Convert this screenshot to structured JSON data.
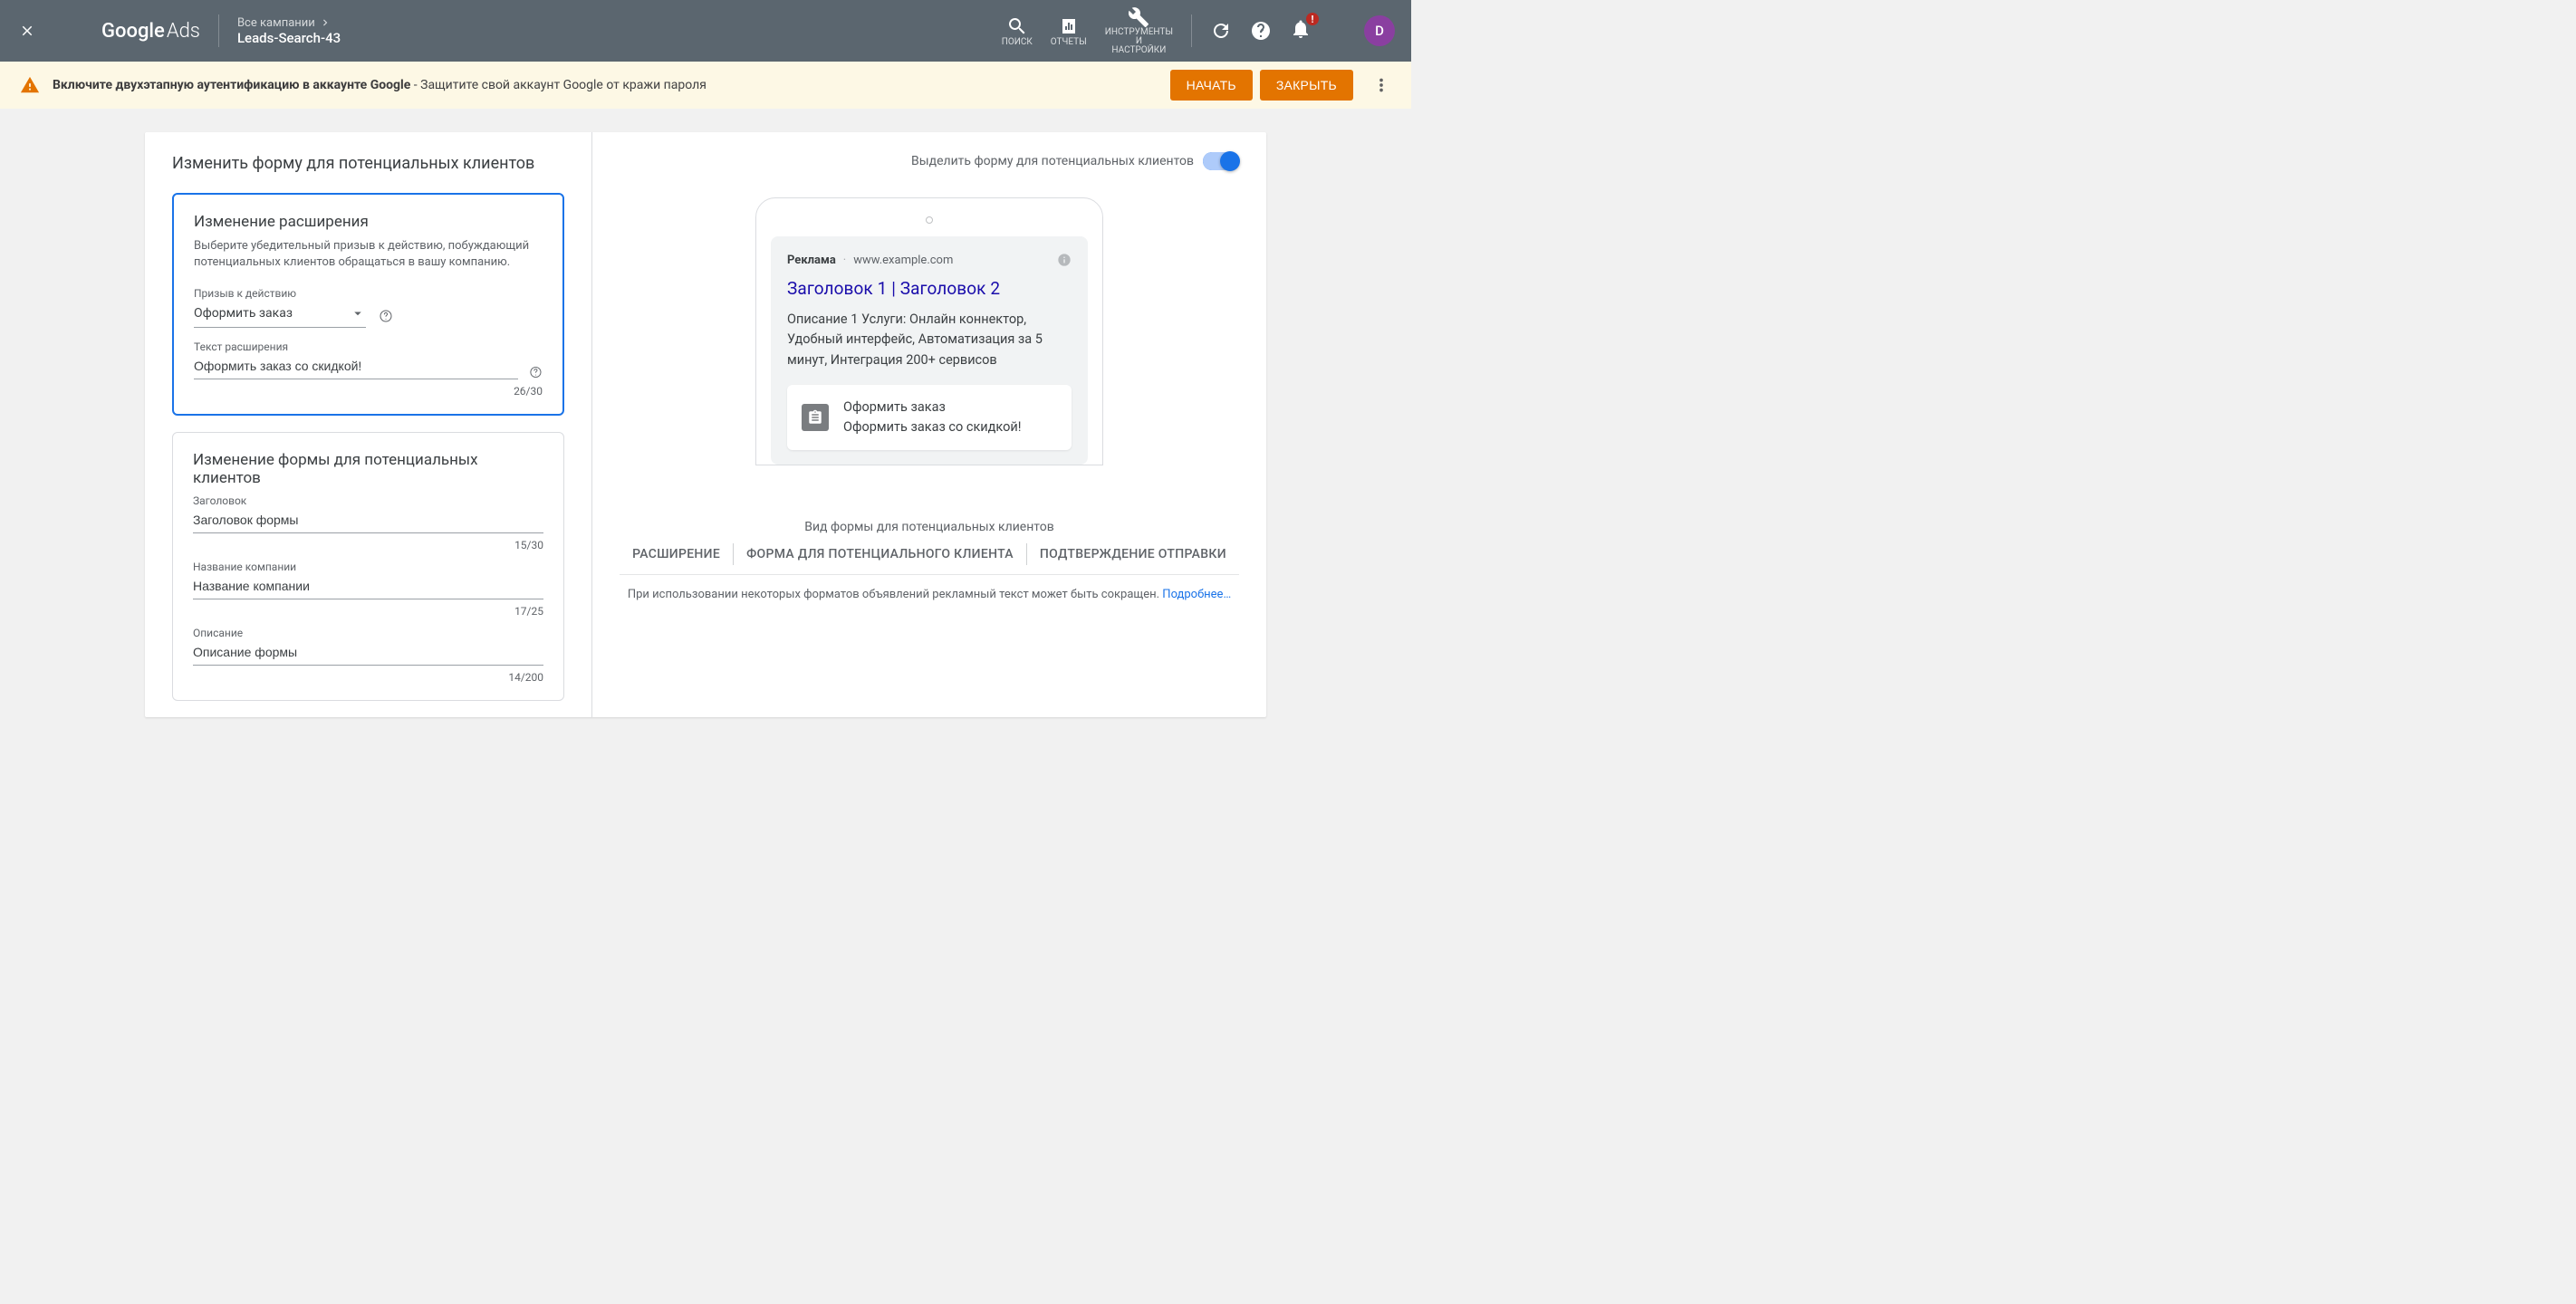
{
  "header": {
    "logo_part1": "Google",
    "logo_part2": "Ads",
    "crumb_top": "Все кампании",
    "crumb_bottom": "Leads-Search-43",
    "actions": {
      "search": "ПОИСК",
      "reports": "ОТЧЕТЫ",
      "tools_line1": "ИНСТРУМЕНТЫ",
      "tools_line2": "И",
      "tools_line3": "НАСТРОЙКИ"
    },
    "notify_badge": "!",
    "account_id": "",
    "avatar_letter": "D"
  },
  "alert": {
    "bold": "Включите двухэтапную аутентификацию в аккаунте Google",
    "rest": " - Защитите свой аккаунт Google от кражи пароля",
    "start": "НАЧАТЬ",
    "close": "ЗАКРЫТЬ"
  },
  "left": {
    "title": "Изменить форму для потенциальных клиентов",
    "card1": {
      "title": "Изменение расширения",
      "sub": "Выберите убедительный призыв к действию, побуждающий потенциальных клиентов обращаться в вашу компанию.",
      "cta_label": "Призыв к действию",
      "cta_value": "Оформить заказ",
      "ext_text_label": "Текст расширения",
      "ext_text_value": "Оформить заказ со скидкой!",
      "ext_counter": "26/30"
    },
    "card2": {
      "title": "Изменение формы для потенциальных клиентов",
      "headline_label": "Заголовок",
      "headline_value": "Заголовок формы",
      "headline_counter": "15/30",
      "company_label": "Название компании",
      "company_value": "Название компании",
      "company_counter": "17/25",
      "desc_label": "Описание",
      "desc_value": "Описание формы",
      "desc_counter": "14/200"
    }
  },
  "right": {
    "toggle_label": "Выделить форму для потенциальных клиентов",
    "ad": {
      "badge": "Реклама",
      "url": "www.example.com",
      "headline": "Заголовок 1 | Заголовок 2",
      "desc": "Описание 1 Услуги: Онлайн коннектор, Удобный интерфейс, Автоматизация за 5 минут, Интеграция 200+ сервисов",
      "ext_line1": "Оформить заказ",
      "ext_line2": "Оформить заказ со скидкой!"
    },
    "preview_caption": "Вид формы для потенциальных клиентов",
    "tabs": {
      "t1": "РАСШИРЕНИЕ",
      "t2": "ФОРМА ДЛЯ ПОТЕНЦИАЛЬНОГО КЛИЕНТА",
      "t3": "ПОДТВЕРЖДЕНИЕ ОТПРАВКИ"
    },
    "footnote_text": "При использовании некоторых форматов объявлений рекламный текст может быть сокращен. ",
    "footnote_link": "Подробнее…"
  }
}
